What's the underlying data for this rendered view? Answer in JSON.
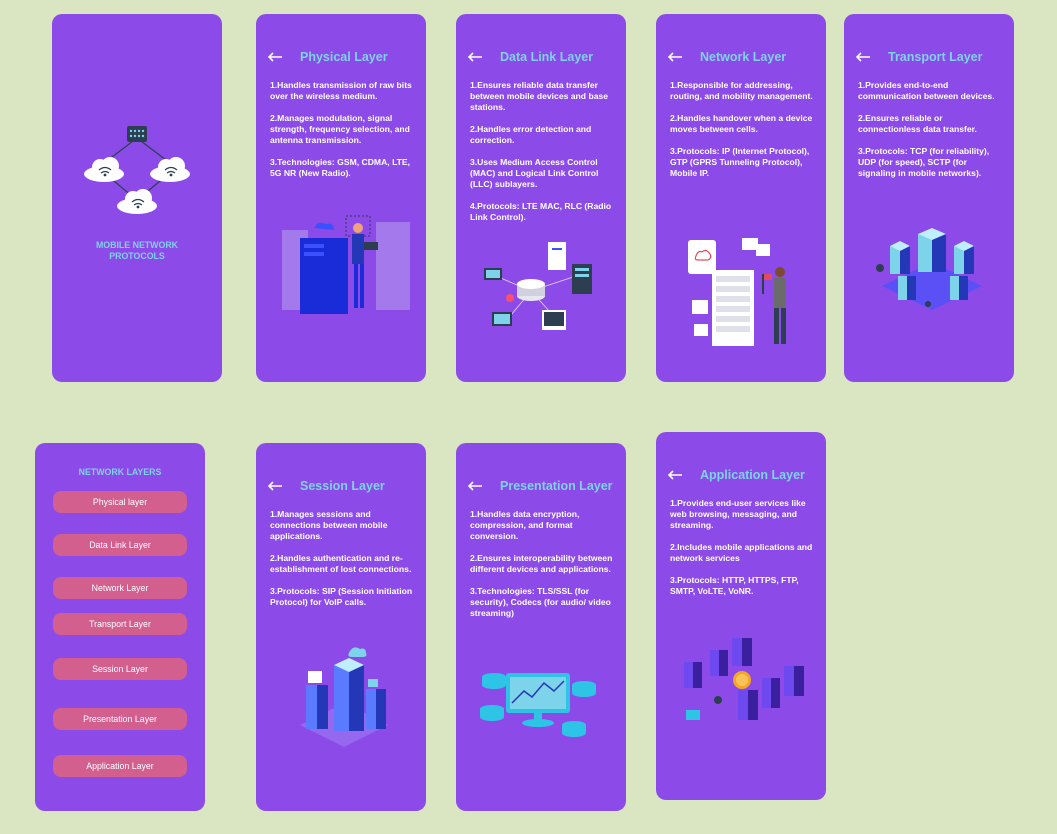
{
  "splash": {
    "title_line1": "MOBILE NETWORK",
    "title_line2": "PROTOCOLS"
  },
  "menu": {
    "heading": "NETWORK LAYERS",
    "items": [
      {
        "label": "Physical layer"
      },
      {
        "label": "Data Link Layer"
      },
      {
        "label": "Network Layer"
      },
      {
        "label": "Transport Layer"
      },
      {
        "label": "Session Layer"
      },
      {
        "label": "Presentation Layer"
      },
      {
        "label": "Application Layer"
      }
    ]
  },
  "cards": {
    "physical": {
      "title": "Physical Layer",
      "points": [
        "1.Handles transmission of raw bits over the wireless medium.",
        "2.Manages modulation, signal strength, frequency selection, and antenna transmission.",
        "3.Technologies: GSM, CDMA, LTE, 5G NR (New Radio)."
      ]
    },
    "datalink": {
      "title": "Data Link Layer",
      "points": [
        "1.Ensures reliable data transfer between mobile devices and base stations.",
        "2.Handles error detection and correction.",
        "3.Uses Medium Access Control (MAC) and Logical Link Control (LLC) sublayers.",
        "4.Protocols: LTE MAC, RLC (Radio Link Control)."
      ]
    },
    "network": {
      "title": "Network Layer",
      "points": [
        "1.Responsible for addressing, routing, and mobility management.",
        "2.Handles handover when a device moves between cells.",
        "3.Protocols: IP (Internet Protocol), GTP (GPRS Tunneling Protocol), Mobile IP."
      ]
    },
    "transport": {
      "title": "Transport Layer",
      "points": [
        "1.Provides end-to-end communication between devices.",
        "2.Ensures reliable or connectionless data transfer.",
        "3.Protocols: TCP (for reliability), UDP (for speed), SCTP (for signaling in mobile networks)."
      ]
    },
    "session": {
      "title": "Session Layer",
      "points": [
        "1.Manages sessions and connections between mobile applications.",
        "2.Handles authentication and re-establishment of lost connections.",
        "3.Protocols: SIP (Session Initiation Protocol) for VoIP calls."
      ]
    },
    "presentation": {
      "title": "Presentation Layer",
      "points": [
        "1.Handles data encryption, compression, and format conversion.",
        "2.Ensures interoperability between different devices and applications.",
        "3.Technologies: TLS/SSL (for security), Codecs (for audio/ video streaming)"
      ]
    },
    "application": {
      "title": "Application Layer",
      "points": [
        "1.Provides end-user services like web browsing, messaging, and streaming.",
        "2.Includes mobile applications and network services",
        "3.Protocols: HTTP, HTTPS, FTP, SMTP, VoLTE, VoNR."
      ]
    }
  },
  "icons": {
    "back": "arrow-left-icon",
    "cloud": "cloud-wifi-icon",
    "server": "server-icon"
  },
  "colors": {
    "background": "#dae5c2",
    "card": "#8c4be9",
    "title_accent": "#7cd3ea",
    "menu_pill": "#d35f8f"
  }
}
